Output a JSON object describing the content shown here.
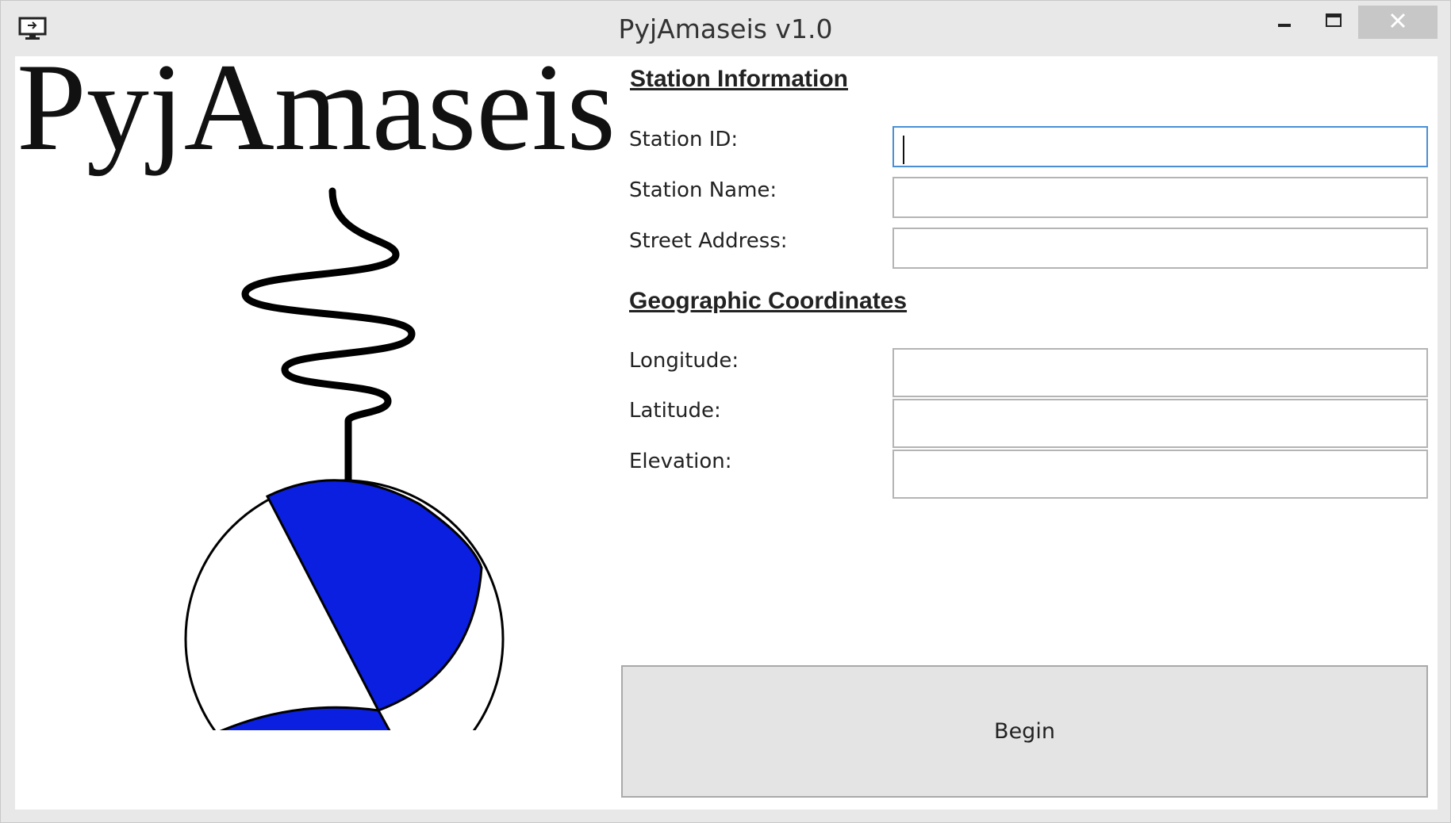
{
  "window": {
    "title": "PyjAmaseis v1.0",
    "icon": "monitor-icon",
    "controls": [
      "minimize-icon",
      "maximize-icon",
      "close-icon"
    ]
  },
  "logo": {
    "text": "PyjAmaseis",
    "colors": {
      "fill": "#0a1fe0",
      "line": "#000000"
    }
  },
  "station_information": {
    "header": "Station Information",
    "fields": [
      {
        "label": "Station ID:",
        "value": ""
      },
      {
        "label": "Station Name:",
        "value": ""
      },
      {
        "label": "Street Address:",
        "value": ""
      }
    ]
  },
  "geographic_coordinates": {
    "header": "Geographic Coordinates",
    "fields": [
      {
        "label": "Longitude:",
        "value": ""
      },
      {
        "label": "Latitude:",
        "value": ""
      },
      {
        "label": "Elevation:",
        "value": ""
      }
    ]
  },
  "begin_button": {
    "label": "Begin"
  },
  "colors": {
    "focus_border": "#4a8fd4",
    "close_button_bg": "#c7c7c7",
    "window_bg": "#e8e8e8"
  }
}
